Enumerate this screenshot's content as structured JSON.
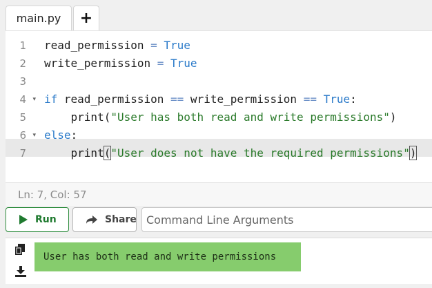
{
  "tabs": {
    "file_name": "main.py",
    "add_label": "+"
  },
  "editor": {
    "line_numbers": [
      "1",
      "2",
      "3",
      "4",
      "5",
      "6",
      "7"
    ],
    "lines": {
      "l1": {
        "name": "read_permission",
        "eq": " = ",
        "val": "True"
      },
      "l2": {
        "name": "write_permission",
        "eq": " = ",
        "val": "True"
      },
      "l4": {
        "kw_if": "if",
        "a": " read_permission ",
        "op1": "==",
        "b": " write_permission ",
        "op2": "==",
        "t": " True",
        "colon": ":"
      },
      "l5": {
        "indent": "    ",
        "fn": "print(",
        "str": "\"User has both read and write permissions\"",
        "close": ")"
      },
      "l6": {
        "kw_else": "else",
        "colon": ":"
      },
      "l7": {
        "indent": "    ",
        "fn": "print",
        "paren": "(",
        "str": "\"User does not have the required permissions\"",
        "close": ")"
      }
    },
    "active_line": 7
  },
  "status": {
    "cursor": "Ln: 7,  Col: 57"
  },
  "toolbar": {
    "run_label": "Run",
    "share_label": "Share",
    "args_placeholder": "Command Line Arguments"
  },
  "output": {
    "text": "User has both read and write permissions"
  },
  "colors": {
    "keyword": "#2a7ac9",
    "string": "#2a7a2a",
    "run": "#1f7a2f",
    "output_bg": "#86cc6d"
  },
  "icons": [
    "play-icon",
    "share-icon",
    "copy-icon",
    "download-icon",
    "fold-arrow-icon"
  ]
}
